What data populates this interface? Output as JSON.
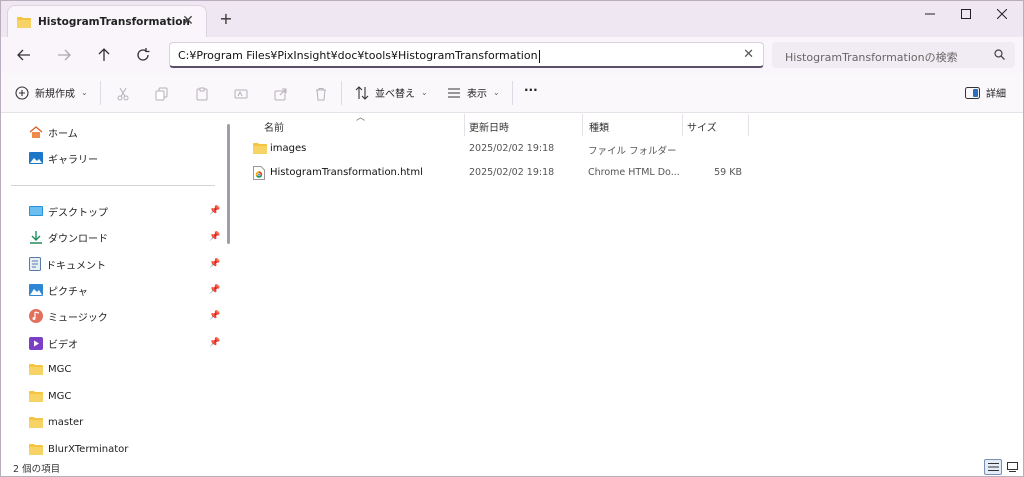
{
  "window": {
    "tab_title": "HistogramTransformation",
    "tab_close": "✕",
    "new_tab": "+"
  },
  "navigation": {
    "address_path": "C:¥Program Files¥PixInsight¥doc¥tools¥HistogramTransformation",
    "clear": "✕",
    "search_placeholder": "HistogramTransformationの検索"
  },
  "command_bar": {
    "new_label": "新規作成",
    "sort_label": "並べ替え",
    "view_label": "表示",
    "more_label": "···",
    "details_label": "詳細"
  },
  "sidebar": {
    "top": [
      {
        "label": "ホーム",
        "icon": "home-icon"
      },
      {
        "label": "ギャラリー",
        "icon": "gallery-icon"
      }
    ],
    "quick_access": [
      {
        "label": "デスクトップ",
        "icon": "desktop-icon",
        "pinned": true
      },
      {
        "label": "ダウンロード",
        "icon": "download-icon",
        "pinned": true
      },
      {
        "label": "ドキュメント",
        "icon": "document-icon",
        "pinned": true
      },
      {
        "label": "ピクチャ",
        "icon": "pictures-icon",
        "pinned": true
      },
      {
        "label": "ミュージック",
        "icon": "music-icon",
        "pinned": true
      },
      {
        "label": "ビデオ",
        "icon": "video-icon",
        "pinned": true
      },
      {
        "label": "MGC",
        "icon": "folder-icon",
        "pinned": false
      },
      {
        "label": "MGC",
        "icon": "folder-icon",
        "pinned": false
      },
      {
        "label": "master",
        "icon": "folder-icon",
        "pinned": false
      },
      {
        "label": "BlurXTerminator",
        "icon": "folder-icon",
        "pinned": false
      }
    ]
  },
  "file_list": {
    "columns": [
      "名前",
      "更新日時",
      "種類",
      "サイズ"
    ],
    "rows": [
      {
        "name": "images",
        "modified": "2025/02/02 19:18",
        "type": "ファイル フォルダー",
        "size": "",
        "icon": "folder-icon"
      },
      {
        "name": "HistogramTransformation.html",
        "modified": "2025/02/02 19:18",
        "type": "Chrome HTML Do...",
        "size": "59 KB",
        "icon": "chrome-html-icon"
      }
    ]
  },
  "status_bar": {
    "item_count": "2 個の項目"
  },
  "colors": {
    "titlebar": "#efe7f1",
    "folder": "#f4c542",
    "accent": "#5b4f68"
  }
}
